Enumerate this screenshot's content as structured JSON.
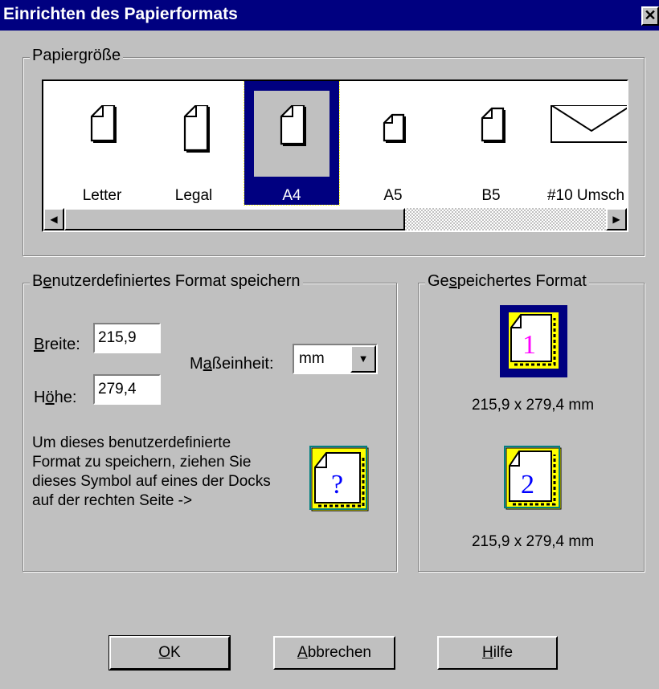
{
  "window": {
    "title": "Einrichten des Papierformats",
    "close_label": "✕"
  },
  "paper_size": {
    "group_label_pre": "Papier",
    "group_label_acc": "g",
    "group_label_post": "röße",
    "items": [
      {
        "label": "Letter",
        "icon": "page-icon"
      },
      {
        "label": "Legal",
        "icon": "page-icon"
      },
      {
        "label": "A4",
        "icon": "page-icon",
        "selected": true
      },
      {
        "label": "A5",
        "icon": "page-icon"
      },
      {
        "label": "B5",
        "icon": "page-icon"
      },
      {
        "label": "#10 Umsch",
        "icon": "envelope-icon"
      }
    ],
    "scroll_left": "◀",
    "scroll_right": "▶"
  },
  "custom_format": {
    "group_label_pre": "B",
    "group_label_acc": "e",
    "group_label_post": "nutzerdefiniertes Format speichern",
    "width_label_acc": "B",
    "width_label_rest": "reite:",
    "width_value": "215,9",
    "height_label_pre": "H",
    "height_label_acc": "ö",
    "height_label_post": "he:",
    "unit_label_pre": "M",
    "unit_label_acc": "a",
    "unit_label_post": "ßeinheit:",
    "unit_value": "mm",
    "unit_arrow": "▼",
    "height_value": "279,4",
    "help_line1": "Um dieses benutzerdefinierte",
    "help_line2": "Format zu speichern, ziehen Sie",
    "help_line3": "dieses Symbol auf eines der Docks",
    "help_line4": "auf der rechten Seite ->",
    "drag_icon_char": "?"
  },
  "saved_format": {
    "group_label_pre": "Ge",
    "group_label_acc": "s",
    "group_label_post": "peichertes Format",
    "slot1_char": "1",
    "slot1_text": "215,9 x 279,4 mm",
    "slot2_char": "2",
    "slot2_text": "215,9 x 279,4 mm"
  },
  "buttons": {
    "ok_acc": "O",
    "ok_rest": "K",
    "cancel_acc": "A",
    "cancel_rest": "bbrechen",
    "help_acc": "H",
    "help_rest": "ilfe"
  }
}
